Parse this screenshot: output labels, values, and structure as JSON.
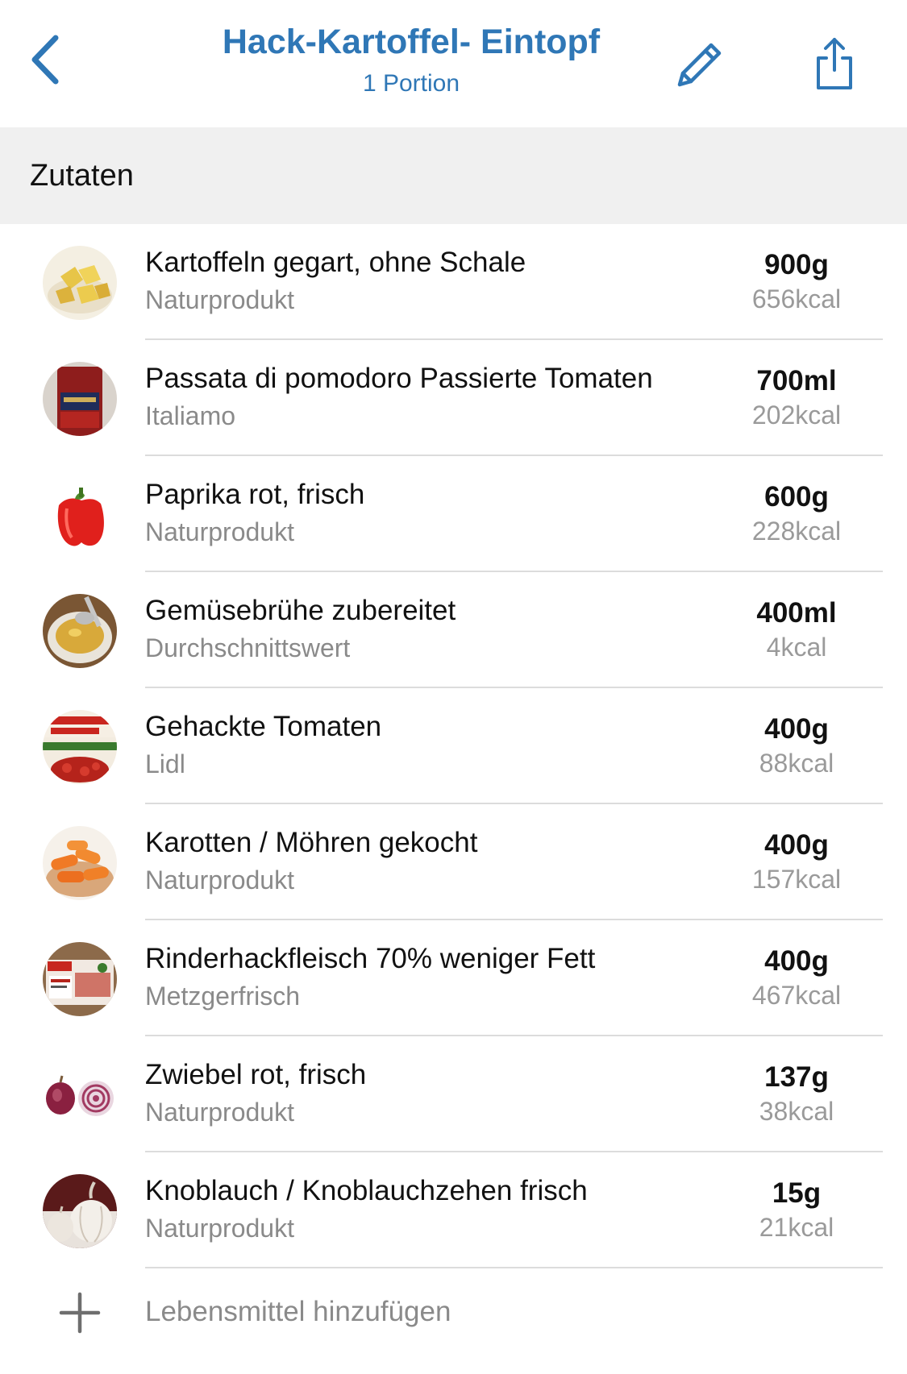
{
  "header": {
    "title": "Hack-Kartoffel- Eintopf",
    "subtitle": "1 Portion",
    "back_icon": "chevron-left-icon",
    "edit_icon": "pencil-icon",
    "share_icon": "share-icon"
  },
  "section": {
    "title": "Zutaten"
  },
  "ingredients": [
    {
      "name": "Kartoffeln gegart, ohne Schale",
      "brand": "Naturprodukt",
      "amount": "900g",
      "kcal": "656kcal"
    },
    {
      "name": "Passata di pomodoro Passierte Tomaten",
      "brand": "Italiamo",
      "amount": "700ml",
      "kcal": "202kcal"
    },
    {
      "name": "Paprika rot, frisch",
      "brand": "Naturprodukt",
      "amount": "600g",
      "kcal": "228kcal"
    },
    {
      "name": "Gemüsebrühe zubereitet",
      "brand": "Durchschnittswert",
      "amount": "400ml",
      "kcal": "4kcal"
    },
    {
      "name": "Gehackte Tomaten",
      "brand": "Lidl",
      "amount": "400g",
      "kcal": "88kcal"
    },
    {
      "name": "Karotten / Möhren gekocht",
      "brand": "Naturprodukt",
      "amount": "400g",
      "kcal": "157kcal"
    },
    {
      "name": "Rinderhackfleisch 70% weniger Fett",
      "brand": "Metzgerfrisch",
      "amount": "400g",
      "kcal": "467kcal"
    },
    {
      "name": "Zwiebel rot, frisch",
      "brand": "Naturprodukt",
      "amount": "137g",
      "kcal": "38kcal"
    },
    {
      "name": "Knoblauch / Knoblauchzehen frisch",
      "brand": "Naturprodukt",
      "amount": "15g",
      "kcal": "21kcal"
    }
  ],
  "add": {
    "label": "Lebensmittel hinzufügen",
    "icon": "plus-icon"
  },
  "colors": {
    "accent": "#2f77b6",
    "section_bg": "#f0f0f0",
    "secondary_text": "#8a8a8a"
  }
}
